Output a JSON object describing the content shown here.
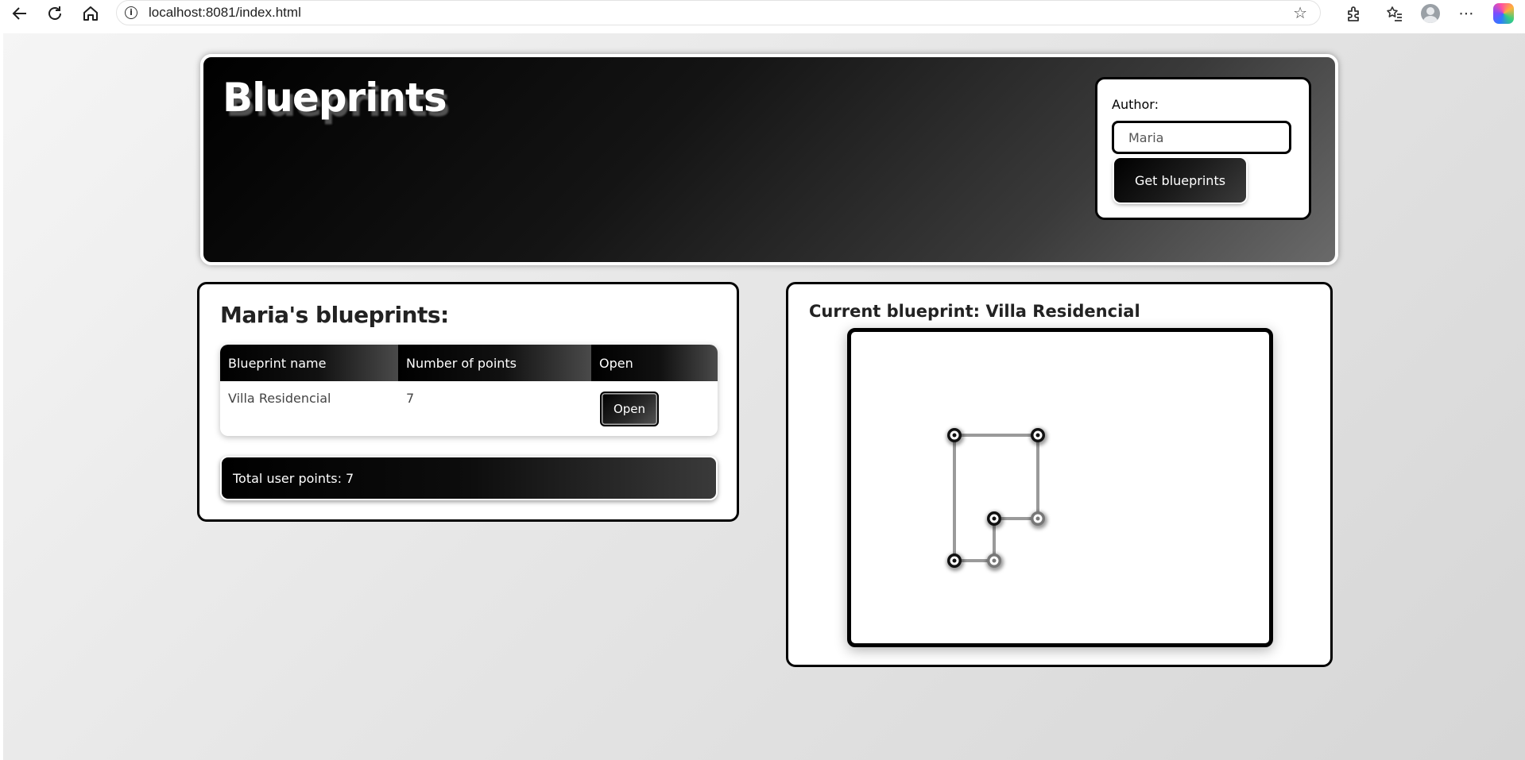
{
  "browser": {
    "url": "localhost:8081/index.html"
  },
  "header": {
    "title": "Blueprints",
    "author_label": "Author:",
    "author_value": "Maria",
    "get_button": "Get blueprints"
  },
  "blueprints": {
    "heading": "Maria's blueprints:",
    "columns": [
      "Blueprint name",
      "Number of points",
      "Open"
    ],
    "rows": [
      {
        "name": "Villa Residencial",
        "points": "7",
        "action": "Open"
      }
    ],
    "total": "Total user points: 7"
  },
  "current": {
    "title": "Current blueprint: Villa Residencial",
    "points": [
      [
        130,
        130
      ],
      [
        235,
        130
      ],
      [
        235,
        235
      ],
      [
        180,
        235
      ],
      [
        180,
        288
      ],
      [
        130,
        288
      ],
      [
        130,
        130
      ]
    ]
  },
  "colors": {
    "accent": "#000000",
    "header_gradient_end": "#6a6a6a"
  }
}
